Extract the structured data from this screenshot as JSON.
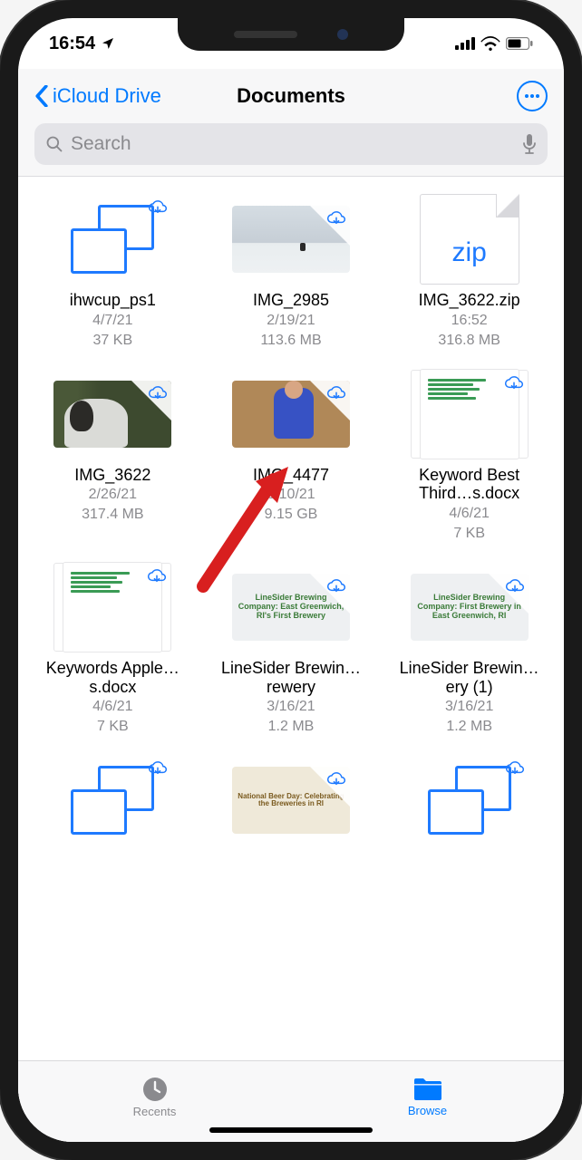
{
  "status": {
    "time": "16:54",
    "location_icon": "location-arrow-icon"
  },
  "nav": {
    "back_label": "iCloud Drive",
    "title": "Documents"
  },
  "search": {
    "placeholder": "Search"
  },
  "files": [
    {
      "name": "ihwcup_ps1",
      "date": "4/7/21",
      "size": "37 KB",
      "kind": "stack"
    },
    {
      "name": "IMG_2985",
      "date": "2/19/21",
      "size": "113.6 MB",
      "kind": "img-snow"
    },
    {
      "name": "IMG_3622.zip",
      "date": "16:52",
      "size": "316.8 MB",
      "kind": "zip"
    },
    {
      "name": "IMG_3622",
      "date": "2/26/21",
      "size": "317.4 MB",
      "kind": "img-dog"
    },
    {
      "name": "IMG_4477",
      "date": "3/10/21",
      "size": "9.15 GB",
      "kind": "img-person"
    },
    {
      "name": "Keyword Best Third…s.docx",
      "date": "4/6/21",
      "size": "7 KB",
      "kind": "doc"
    },
    {
      "name": "Keywords Apple…s.docx",
      "date": "4/6/21",
      "size": "7 KB",
      "kind": "doc"
    },
    {
      "name": "LineSider Brewin…rewery",
      "date": "3/16/21",
      "size": "1.2 MB",
      "kind": "img-line1",
      "caption": "LineSider Brewing Company: East Greenwich, RI's First Brewery"
    },
    {
      "name": "LineSider Brewin…ery (1)",
      "date": "3/16/21",
      "size": "1.2 MB",
      "kind": "img-line2",
      "caption": "LineSider Brewing Company: First Brewery in East Greenwich, RI"
    },
    {
      "name": "",
      "date": "",
      "size": "",
      "kind": "stack"
    },
    {
      "name": "",
      "date": "",
      "size": "",
      "kind": "img-beer",
      "caption": "National Beer Day: Celebrating the Breweries in RI"
    },
    {
      "name": "",
      "date": "",
      "size": "",
      "kind": "stack"
    }
  ],
  "tabs": {
    "recents": "Recents",
    "browse": "Browse"
  }
}
